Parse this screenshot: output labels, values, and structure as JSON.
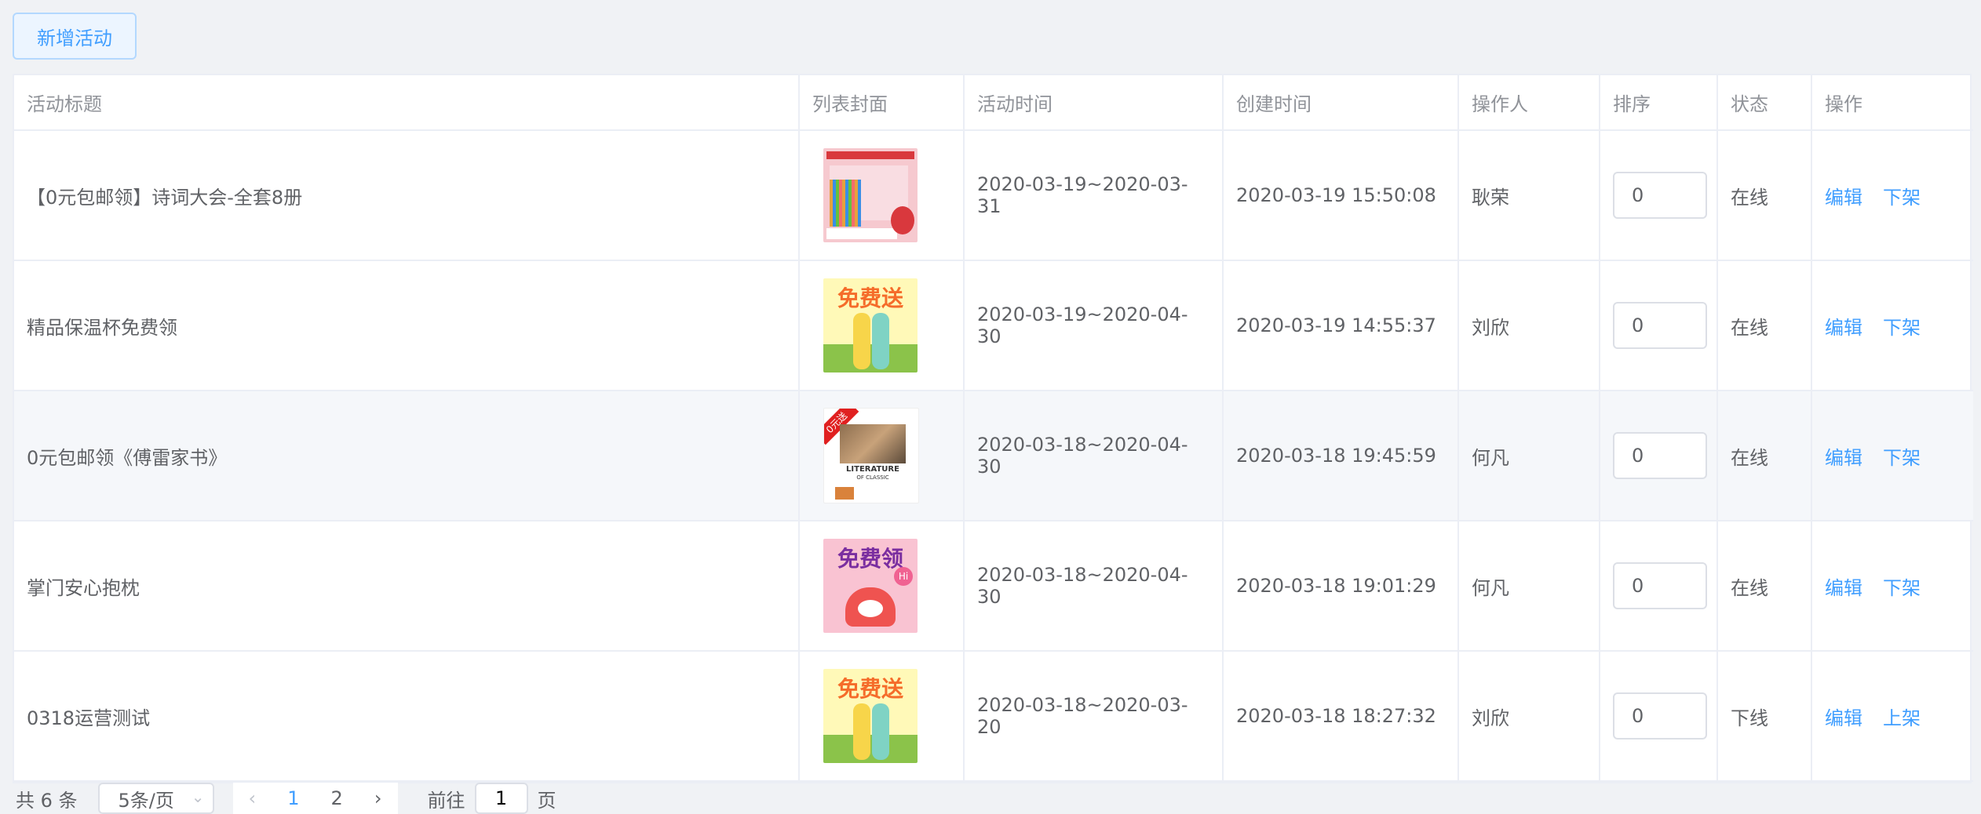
{
  "toolbar": {
    "add_label": "新增活动"
  },
  "table": {
    "headers": [
      "活动标题",
      "列表封面",
      "活动时间",
      "创建时间",
      "操作人",
      "排序",
      "状态",
      "操作"
    ],
    "rows": [
      {
        "title": "【0元包邮领】诗词大会-全套8册",
        "cover": "poetry-books-cover",
        "period": "2020-03-19~2020-03-31",
        "created": "2020-03-19 15:50:08",
        "operator": "耿荣",
        "sort": "0",
        "status": "在线",
        "edit": "编辑",
        "toggle": "下架"
      },
      {
        "title": "精品保温杯免费领",
        "cover": "thermos-free-send-cover",
        "period": "2020-03-19~2020-04-30",
        "created": "2020-03-19 14:55:37",
        "operator": "刘欣",
        "sort": "0",
        "status": "在线",
        "edit": "编辑",
        "toggle": "下架"
      },
      {
        "title": "0元包邮领《傅雷家书》",
        "cover": "fu-lei-book-cover",
        "period": "2020-03-18~2020-04-30",
        "created": "2020-03-18 19:45:59",
        "operator": "何凡",
        "sort": "0",
        "status": "在线",
        "edit": "编辑",
        "toggle": "下架"
      },
      {
        "title": "掌门安心抱枕",
        "cover": "pillow-free-get-cover",
        "period": "2020-03-18~2020-04-30",
        "created": "2020-03-18 19:01:29",
        "operator": "何凡",
        "sort": "0",
        "status": "在线",
        "edit": "编辑",
        "toggle": "下架"
      },
      {
        "title": "0318运营测试",
        "cover": "thermos-free-send-cover",
        "period": "2020-03-18~2020-03-20",
        "created": "2020-03-18 18:27:32",
        "operator": "刘欣",
        "sort": "0",
        "status": "下线",
        "edit": "编辑",
        "toggle": "上架"
      }
    ]
  },
  "covers": {
    "free_send": "免费送",
    "free_get": "免费领",
    "zero_ship": "0元送",
    "literature": "LITERATURE",
    "of_classic": "OF CLASSIC",
    "hi": "Hi"
  },
  "pagination": {
    "total": "共 6 条",
    "page_size": "5条/页",
    "pages": [
      "1",
      "2"
    ],
    "current": "1",
    "goto_prefix": "前往",
    "goto_value": "1",
    "goto_suffix": "页"
  },
  "colors": {
    "accent": "#409eff",
    "border": "#ebeef5",
    "hover_row": "#f5f7fa"
  }
}
